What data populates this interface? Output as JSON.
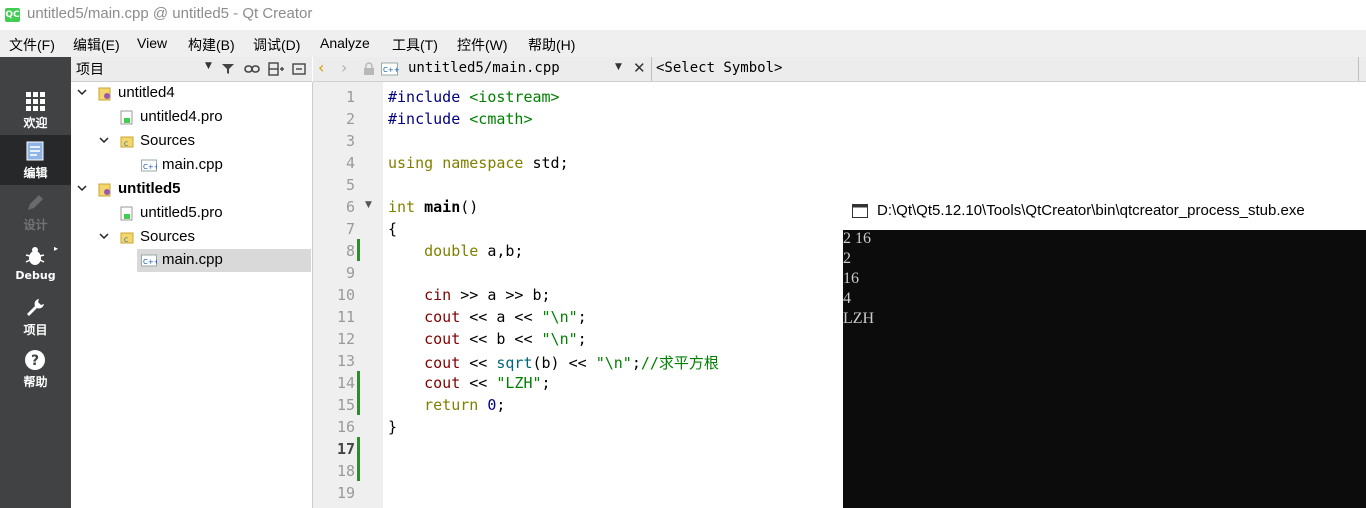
{
  "window": {
    "title": "untitled5/main.cpp @ untitled5 - Qt Creator",
    "app_icon_text": "QC"
  },
  "menu": [
    "文件(F)",
    "编辑(E)",
    "View",
    "构建(B)",
    "调试(D)",
    "Analyze",
    "工具(T)",
    "控件(W)",
    "帮助(H)"
  ],
  "modes": [
    {
      "label": "欢迎",
      "icon": "grid-icon",
      "state": "normal"
    },
    {
      "label": "编辑",
      "icon": "document-icon",
      "state": "active"
    },
    {
      "label": "设计",
      "icon": "pencil-icon",
      "state": "disabled"
    },
    {
      "label": "Debug",
      "icon": "bug-icon",
      "state": "normal"
    },
    {
      "label": "项目",
      "icon": "wrench-icon",
      "state": "normal"
    },
    {
      "label": "帮助",
      "icon": "help-icon",
      "state": "normal"
    }
  ],
  "project_panel": {
    "title": "项目"
  },
  "project_tree": [
    {
      "label": "untitled4",
      "type": "project",
      "expanded": true,
      "bold": false
    },
    {
      "label": "untitled4.pro",
      "type": "pro-file"
    },
    {
      "label": "Sources",
      "type": "folder",
      "expanded": true
    },
    {
      "label": "main.cpp",
      "type": "cpp-file",
      "selected": false
    },
    {
      "label": "untitled5",
      "type": "project",
      "expanded": true,
      "bold": true
    },
    {
      "label": "untitled5.pro",
      "type": "pro-file"
    },
    {
      "label": "Sources",
      "type": "folder",
      "expanded": true
    },
    {
      "label": "main.cpp",
      "type": "cpp-file",
      "selected": true
    }
  ],
  "editor": {
    "file_tab": "untitled5/main.cpp",
    "symbol_selector": "<Select Symbol>",
    "line_numbers": [
      "1",
      "2",
      "3",
      "4",
      "5",
      "6",
      "7",
      "8",
      "9",
      "10",
      "11",
      "12",
      "13",
      "14",
      "15",
      "16",
      "17",
      "18",
      "19"
    ],
    "current_line": "17"
  },
  "code": {
    "l1a": "#include ",
    "l1b": "<iostream>",
    "l2a": "#include ",
    "l2b": "<cmath>",
    "l4a": "using",
    "l4b": " ",
    "l4c": "namespace",
    "l4d": " std;",
    "l6a": "int",
    "l6b": " ",
    "l6c": "main",
    "l6d": "()",
    "l7": "{",
    "l8a": "    ",
    "l8b": "double",
    "l8c": " a,b;",
    "l10a": "    ",
    "l10b": "cin",
    "l10c": " >> a >> b;",
    "l11a": "    ",
    "l11b": "cout",
    "l11c": " << a << ",
    "l11d": "\"\\n\"",
    "l11e": ";",
    "l12a": "    ",
    "l12b": "cout",
    "l12c": " << b << ",
    "l12d": "\"\\n\"",
    "l12e": ";",
    "l13a": "    ",
    "l13b": "cout",
    "l13c": " << ",
    "l13d": "sqrt",
    "l13e": "(b) << ",
    "l13f": "\"\\n\"",
    "l13g": ";",
    "l13h": "//求平方根",
    "l14a": "    ",
    "l14b": "cout",
    "l14c": " << ",
    "l14d": "\"LZH\"",
    "l14e": ";",
    "l15a": "    ",
    "l15b": "return",
    "l15c": " ",
    "l15d": "0",
    "l15e": ";",
    "l16": "}"
  },
  "console": {
    "title": "D:\\Qt\\Qt5.12.10\\Tools\\QtCreator\\bin\\qtcreator_process_stub.exe",
    "lines": [
      "2 16",
      "2",
      "16",
      "4",
      "LZH"
    ]
  },
  "colors": {
    "mode_bar": "#404244",
    "mode_active": "#262829",
    "selection": "#d9d9d9",
    "keyword": "#808000",
    "string": "#008000",
    "console_bg": "#0c0c0c",
    "qt_green": "#41cd52"
  }
}
